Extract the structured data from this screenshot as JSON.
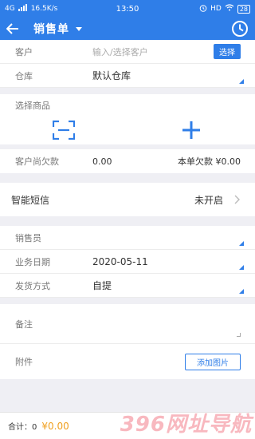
{
  "status_bar": {
    "network": "4G",
    "speed": "16.5K/s",
    "time": "13:50",
    "hd": "HD",
    "battery": "28"
  },
  "app_bar": {
    "title": "销售单"
  },
  "form": {
    "customer": {
      "label": "客户",
      "placeholder": "输入/选择客户",
      "button": "选择"
    },
    "warehouse": {
      "label": "仓库",
      "value": "默认仓库"
    },
    "choose_goods": {
      "label": "选择商品"
    },
    "customer_debt": {
      "label": "客户尚欠款",
      "value": "0.00",
      "bill_debt_label": "本单欠款",
      "bill_debt_value": "¥0.00"
    },
    "sms": {
      "label": "智能短信",
      "state": "未开启"
    },
    "salesperson": {
      "label": "销售员",
      "value": ""
    },
    "business_date": {
      "label": "业务日期",
      "value": "2020-05-11"
    },
    "shipping": {
      "label": "发货方式",
      "value": "自提"
    },
    "remark": {
      "label": "备注"
    },
    "attachment": {
      "label": "附件",
      "button": "添加图片"
    }
  },
  "footer": {
    "count": "合计：0",
    "total": "¥0.00"
  },
  "watermark": {
    "text": "396网址导航"
  },
  "colors": {
    "primary": "#2f7ee8",
    "accent": "#f0a020"
  }
}
